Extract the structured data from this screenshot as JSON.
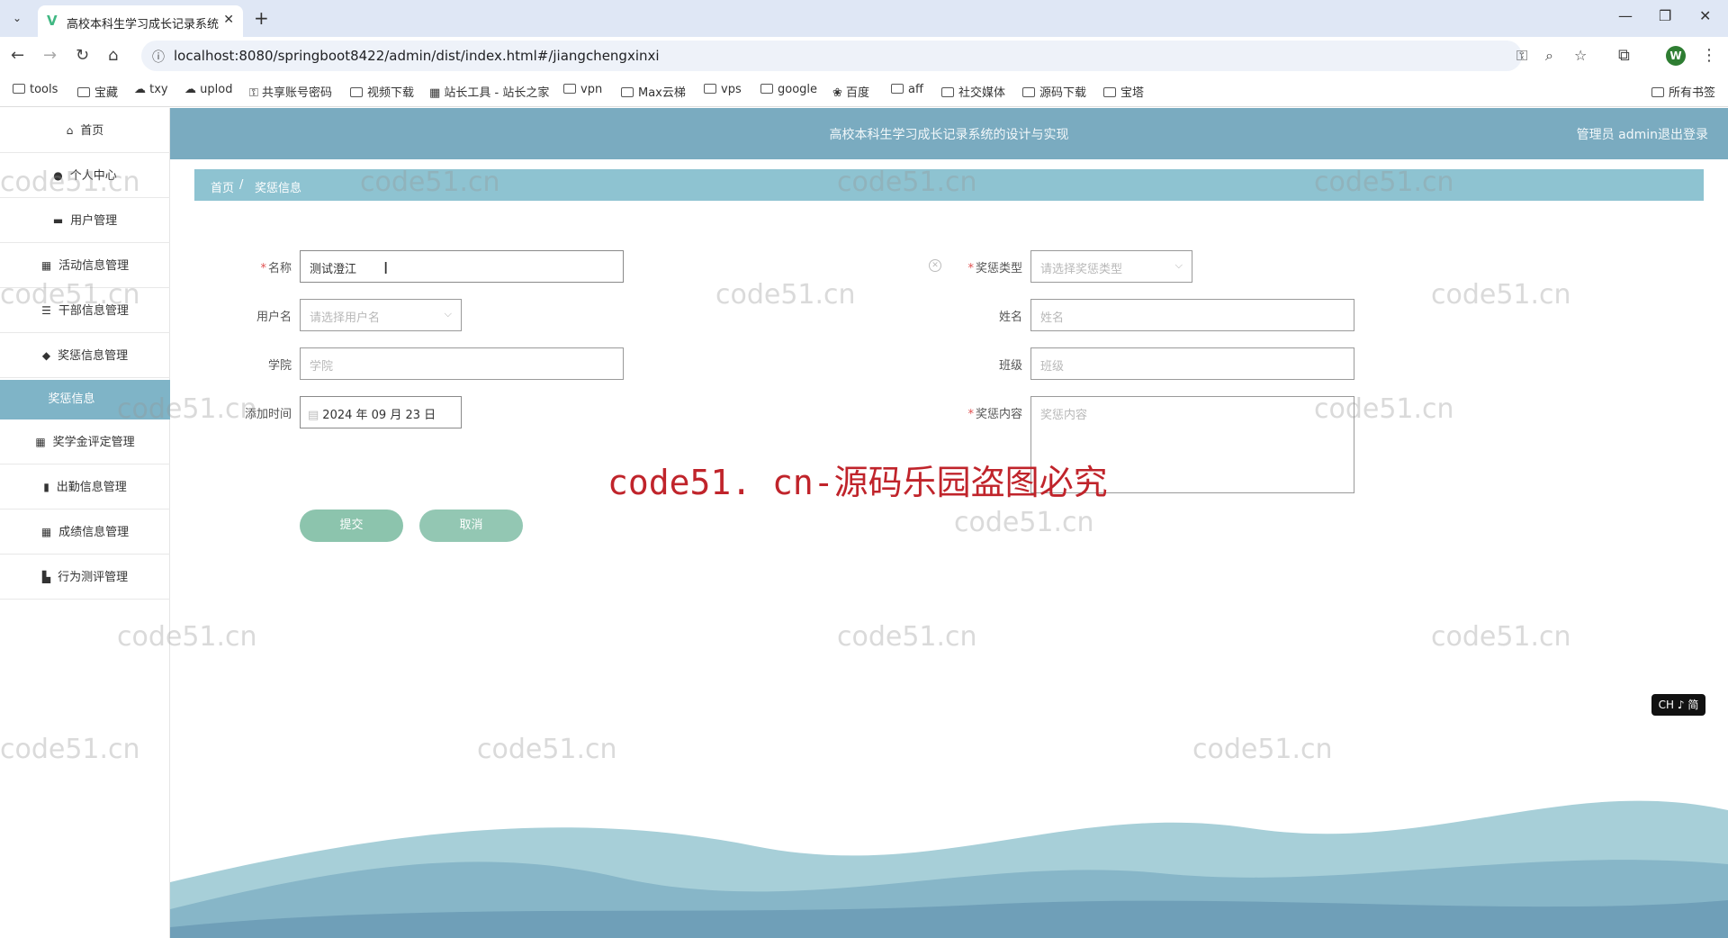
{
  "browser": {
    "tab_title": "高校本科生学习成长记录系统的",
    "url": "localhost:8080/springboot8422/admin/dist/index.html#/jiangchengxinxi",
    "profile_initial": "W",
    "bookmarks": [
      "tools",
      "宝藏",
      "txy",
      "uplod",
      "共享账号密码",
      "视频下载",
      "站长工具 - 站长之家",
      "vpn",
      "Max云梯",
      "vps",
      "google",
      "百度",
      "aff",
      "社交媒体",
      "源码下载",
      "宝塔"
    ],
    "all_bookmarks": "所有书签"
  },
  "sidebar": {
    "items": [
      {
        "label": "首页",
        "icon": "home-icon"
      },
      {
        "label": "个人中心",
        "icon": "user-icon"
      },
      {
        "label": "用户管理",
        "icon": "monitor-icon"
      },
      {
        "label": "活动信息管理",
        "icon": "grid-icon"
      },
      {
        "label": "干部信息管理",
        "icon": "list-icon"
      },
      {
        "label": "奖惩信息管理",
        "icon": "shield-icon"
      },
      {
        "label": "奖学金评定管理",
        "icon": "grid-icon"
      },
      {
        "label": "出勤信息管理",
        "icon": "bar-chart-icon"
      },
      {
        "label": "成绩信息管理",
        "icon": "grid-icon"
      },
      {
        "label": "行为测评管理",
        "icon": "book-icon"
      }
    ],
    "active_sub": "奖惩信息"
  },
  "header": {
    "title": "高校本科生学习成长记录系统的设计与实现",
    "user": "管理员 admin",
    "logout": "退出登录"
  },
  "breadcrumb": {
    "home": "首页",
    "separator": "/",
    "current": "奖惩信息"
  },
  "form": {
    "name_label": "名称",
    "name_value": "测试澄江",
    "type_label": "奖惩类型",
    "type_placeholder": "请选择奖惩类型",
    "username_label": "用户名",
    "username_placeholder": "请选择用户名",
    "realname_label": "姓名",
    "realname_placeholder": "姓名",
    "college_label": "学院",
    "college_placeholder": "学院",
    "class_label": "班级",
    "class_placeholder": "班级",
    "time_label": "添加时间",
    "time_value": "2024 年 09 月 23 日",
    "content_label": "奖惩内容",
    "content_placeholder": "奖惩内容",
    "submit": "提交",
    "cancel": "取消"
  },
  "ime_indicator": "CH ♪ 简",
  "watermark_text": "code51.cn",
  "watermark_banner": "code51. cn-源码乐园盗图必究",
  "colors": {
    "header": "#7aabc0",
    "breadcrumb": "#8ec3d1",
    "button": "#8cc4ad",
    "active_sub": "#7fb4c7"
  }
}
